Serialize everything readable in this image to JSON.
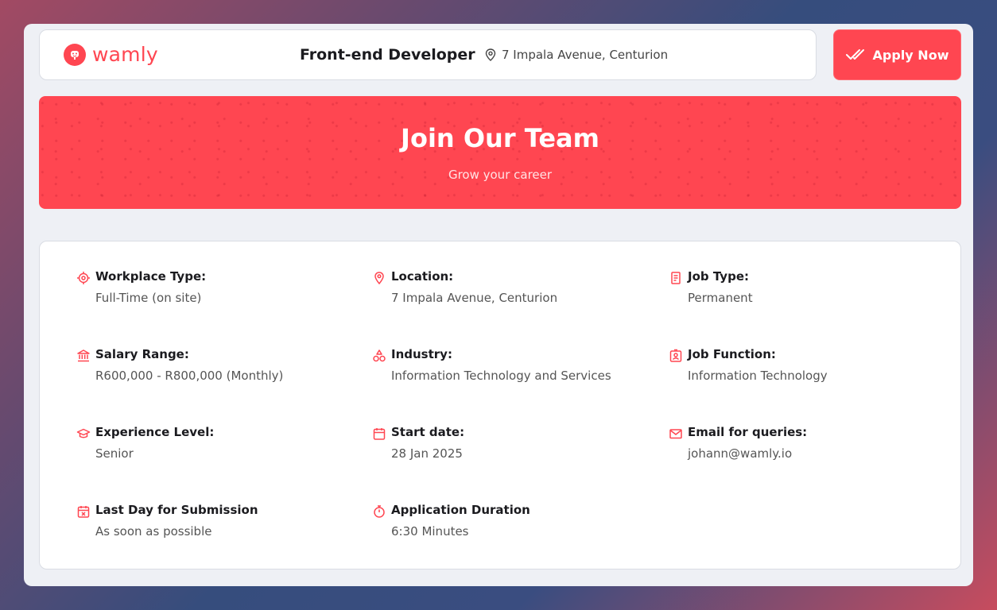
{
  "header": {
    "logo_text": "wamly",
    "job_title": "Front-end Developer",
    "location": "7 Impala Avenue, Centurion",
    "apply_label": "Apply Now"
  },
  "banner": {
    "title": "Join Our Team",
    "subtitle": "Grow your career"
  },
  "details": [
    {
      "icon": "target-icon",
      "label": "Workplace Type:",
      "value": "Full-Time (on site)"
    },
    {
      "icon": "map-pin-icon",
      "label": "Location:",
      "value": "7 Impala Avenue, Centurion"
    },
    {
      "icon": "document-icon",
      "label": "Job Type:",
      "value": "Permanent"
    },
    {
      "icon": "bank-icon",
      "label": "Salary Range:",
      "value": "R600,000 - R800,000 (Monthly)"
    },
    {
      "icon": "shapes-icon",
      "label": "Industry:",
      "value": "Information Technology and Services"
    },
    {
      "icon": "id-badge-icon",
      "label": "Job Function:",
      "value": "Information Technology"
    },
    {
      "icon": "graduation-cap-icon",
      "label": "Experience Level:",
      "value": "Senior"
    },
    {
      "icon": "calendar-icon",
      "label": "Start date:",
      "value": "28 Jan 2025"
    },
    {
      "icon": "mail-icon",
      "label": "Email for queries:",
      "value": "johann@wamly.io"
    },
    {
      "icon": "calendar-x-icon",
      "label": "Last Day for Submission",
      "value": "As soon as possible"
    },
    {
      "icon": "stopwatch-icon",
      "label": "Application Duration",
      "value": "6:30 Minutes"
    }
  ],
  "colors": {
    "accent": "#ff4651",
    "card_bg": "#ffffff",
    "page_bg": "#eef0f5"
  }
}
